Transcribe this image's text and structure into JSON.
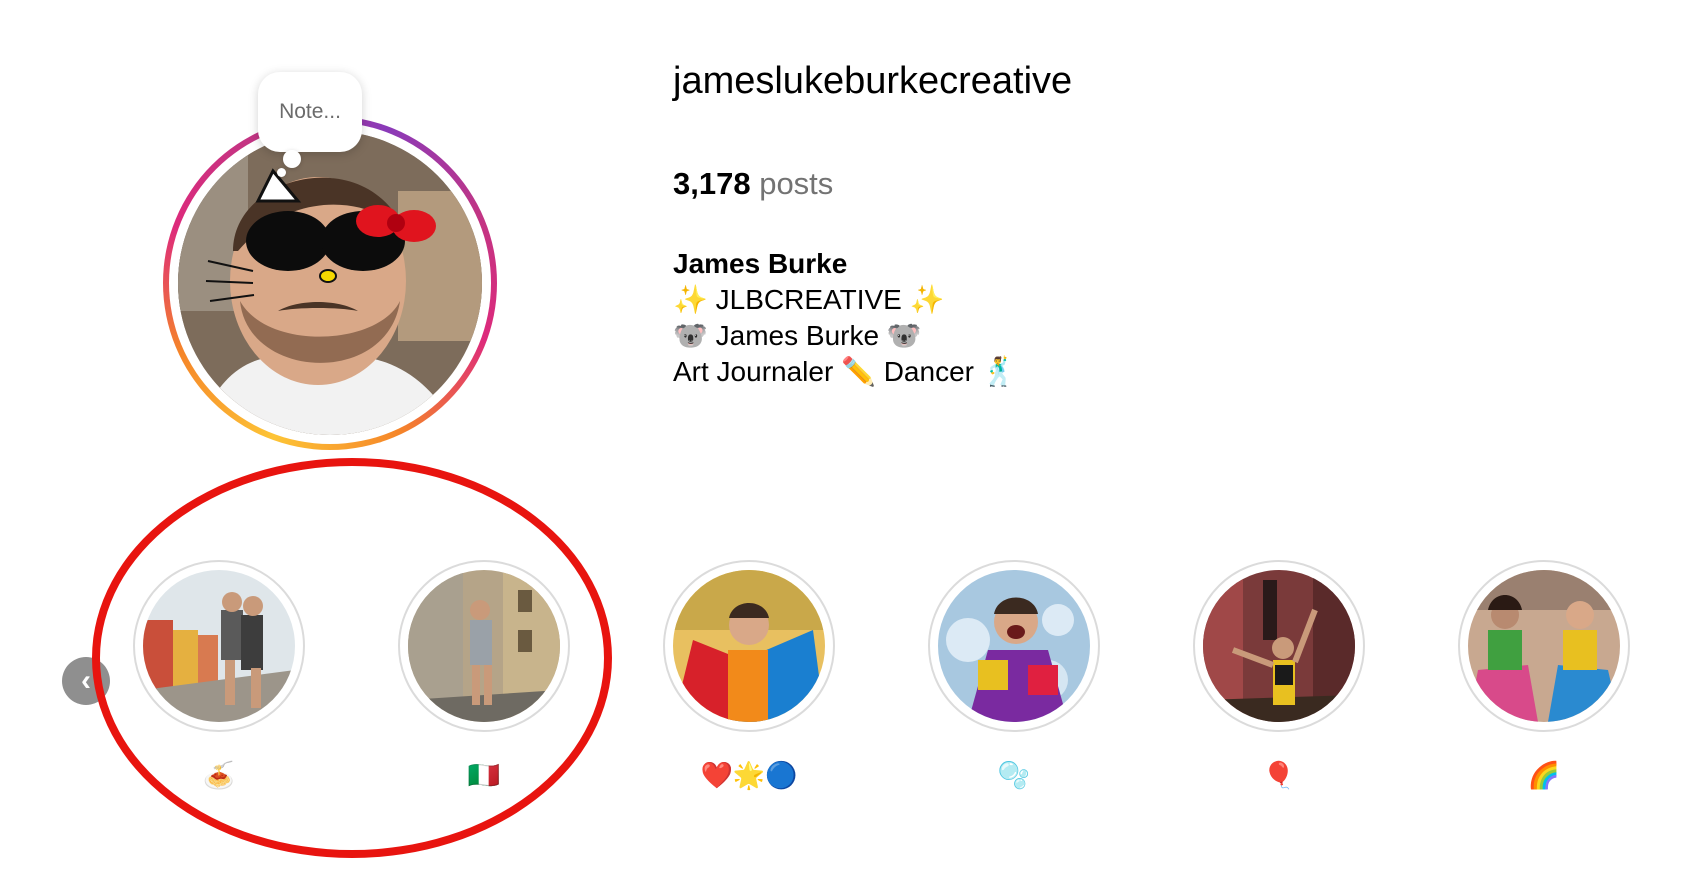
{
  "profile": {
    "note_placeholder": "Note...",
    "username": "jameslukeburkecreative",
    "posts_count": "3,178",
    "posts_label": "posts",
    "bio": {
      "name": "James Burke",
      "line1": "✨ JLBCREATIVE ✨",
      "line2": "🐨 James Burke 🐨",
      "line3": "Art Journaler ✏️ Dancer 🕺"
    }
  },
  "highlights": {
    "prev_icon": "‹",
    "items": [
      {
        "label": "🍝"
      },
      {
        "label": "🇮🇹"
      },
      {
        "label": "❤️🌟🔵"
      },
      {
        "label": "🫧"
      },
      {
        "label": "🎈"
      },
      {
        "label": "🌈"
      }
    ]
  },
  "colors": {
    "story_ring": [
      "#fdc436",
      "#f58529",
      "#dd2a7b",
      "#8a3ab9"
    ],
    "annotation": "#e8140f",
    "muted_text": "#737373"
  }
}
